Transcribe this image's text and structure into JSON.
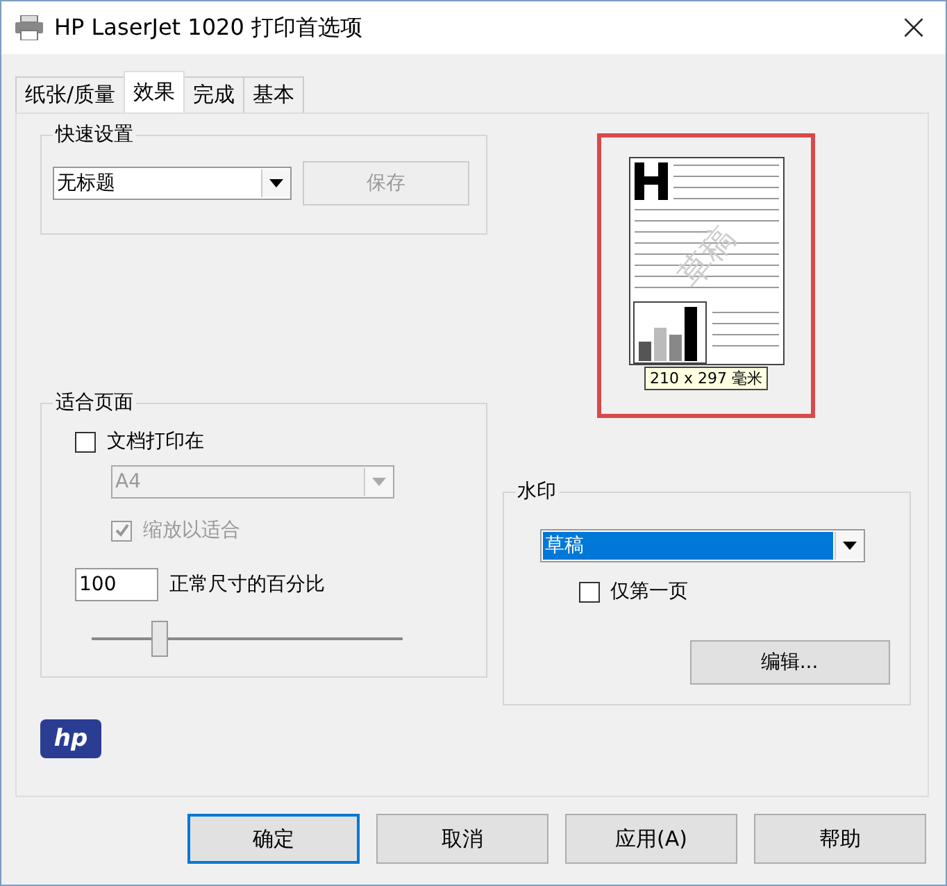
{
  "window": {
    "title": "HP LaserJet 1020 打印首选项",
    "close": "×"
  },
  "tabs": [
    {
      "label": "纸张/质量",
      "selected": false
    },
    {
      "label": "效果",
      "selected": true
    },
    {
      "label": "完成",
      "selected": false
    },
    {
      "label": "基本",
      "selected": false
    }
  ],
  "quick_settings": {
    "title": "快速设置",
    "value": "无标题",
    "save_button": {
      "label": "保存",
      "disabled": true
    }
  },
  "fit_page": {
    "title": "适合页面",
    "print_on": {
      "label": "文档打印在",
      "checked": false
    },
    "paper": {
      "value": "A4",
      "disabled": true
    },
    "scale_to_fit": {
      "label": "缩放以适合",
      "checked": true,
      "disabled": true
    },
    "percent": {
      "value": "100",
      "label": "正常尺寸的百分比"
    },
    "slider": {
      "level": 0.22
    }
  },
  "preview": {
    "watermark_text": "草稿",
    "size_label": "210 x 297 毫米"
  },
  "watermark": {
    "title": "水印",
    "value": "草稿",
    "first_page_only": {
      "label": "仅第一页",
      "checked": false
    },
    "edit_button": "编辑..."
  },
  "logo": "hp",
  "buttons": [
    {
      "label": "确定",
      "selected": true
    },
    {
      "label": "取消",
      "selected": false
    },
    {
      "label": "应用(A)",
      "selected": false
    },
    {
      "label": "帮助",
      "selected": false
    }
  ]
}
